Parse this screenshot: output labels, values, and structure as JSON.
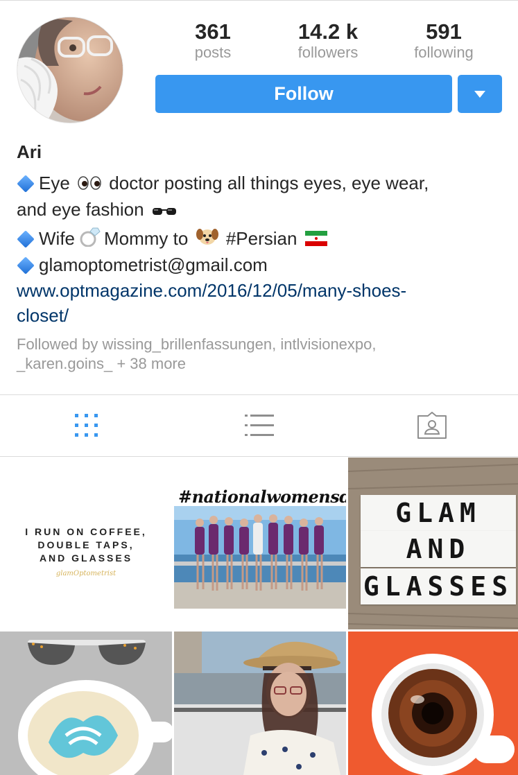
{
  "profile": {
    "username_display": "Ari",
    "avatar_alt": "profile photo"
  },
  "stats": {
    "posts": {
      "value": "361",
      "label": "posts"
    },
    "followers": {
      "value": "14.2 k",
      "label": "followers"
    },
    "following": {
      "value": "591",
      "label": "following"
    }
  },
  "actions": {
    "follow_label": "Follow",
    "dropdown_icon": "caret-down-icon"
  },
  "bio": {
    "line1_a": "Eye",
    "line1_b": "doctor posting all things eyes, eye wear,",
    "line2": "and eye fashion",
    "line3_a": "Wife",
    "line3_b": "Mommy to",
    "line3_c": "#Persian",
    "line4": "glamoptometrist@gmail.com",
    "link_line1": "www.optmagazine.com/2016/12/05/many-shoes-",
    "link_line2": "closet/",
    "followed_line1": "Followed by wissing_brillenfassungen, intlvisionexpo,",
    "followed_line2": "_karen.goins_ + 38 more"
  },
  "tabs": [
    {
      "name": "grid-view",
      "icon": "grid-icon",
      "active": true
    },
    {
      "name": "list-view",
      "icon": "list-icon",
      "active": false
    },
    {
      "name": "tagged-view",
      "icon": "tagged-person-icon",
      "active": false
    }
  ],
  "posts": {
    "coffee_lines": [
      "I RUN ON COFFEE,",
      "DOUBLE TAPS,",
      "AND GLASSES"
    ],
    "coffee_signature": "glamOptometrist",
    "womensday_tag": "#nationalwomensday",
    "glam_lines": [
      "GLAM",
      "AND",
      "GLASSES"
    ]
  },
  "colors": {
    "accent": "#3897f0",
    "link": "#003569",
    "muted": "#999999"
  }
}
